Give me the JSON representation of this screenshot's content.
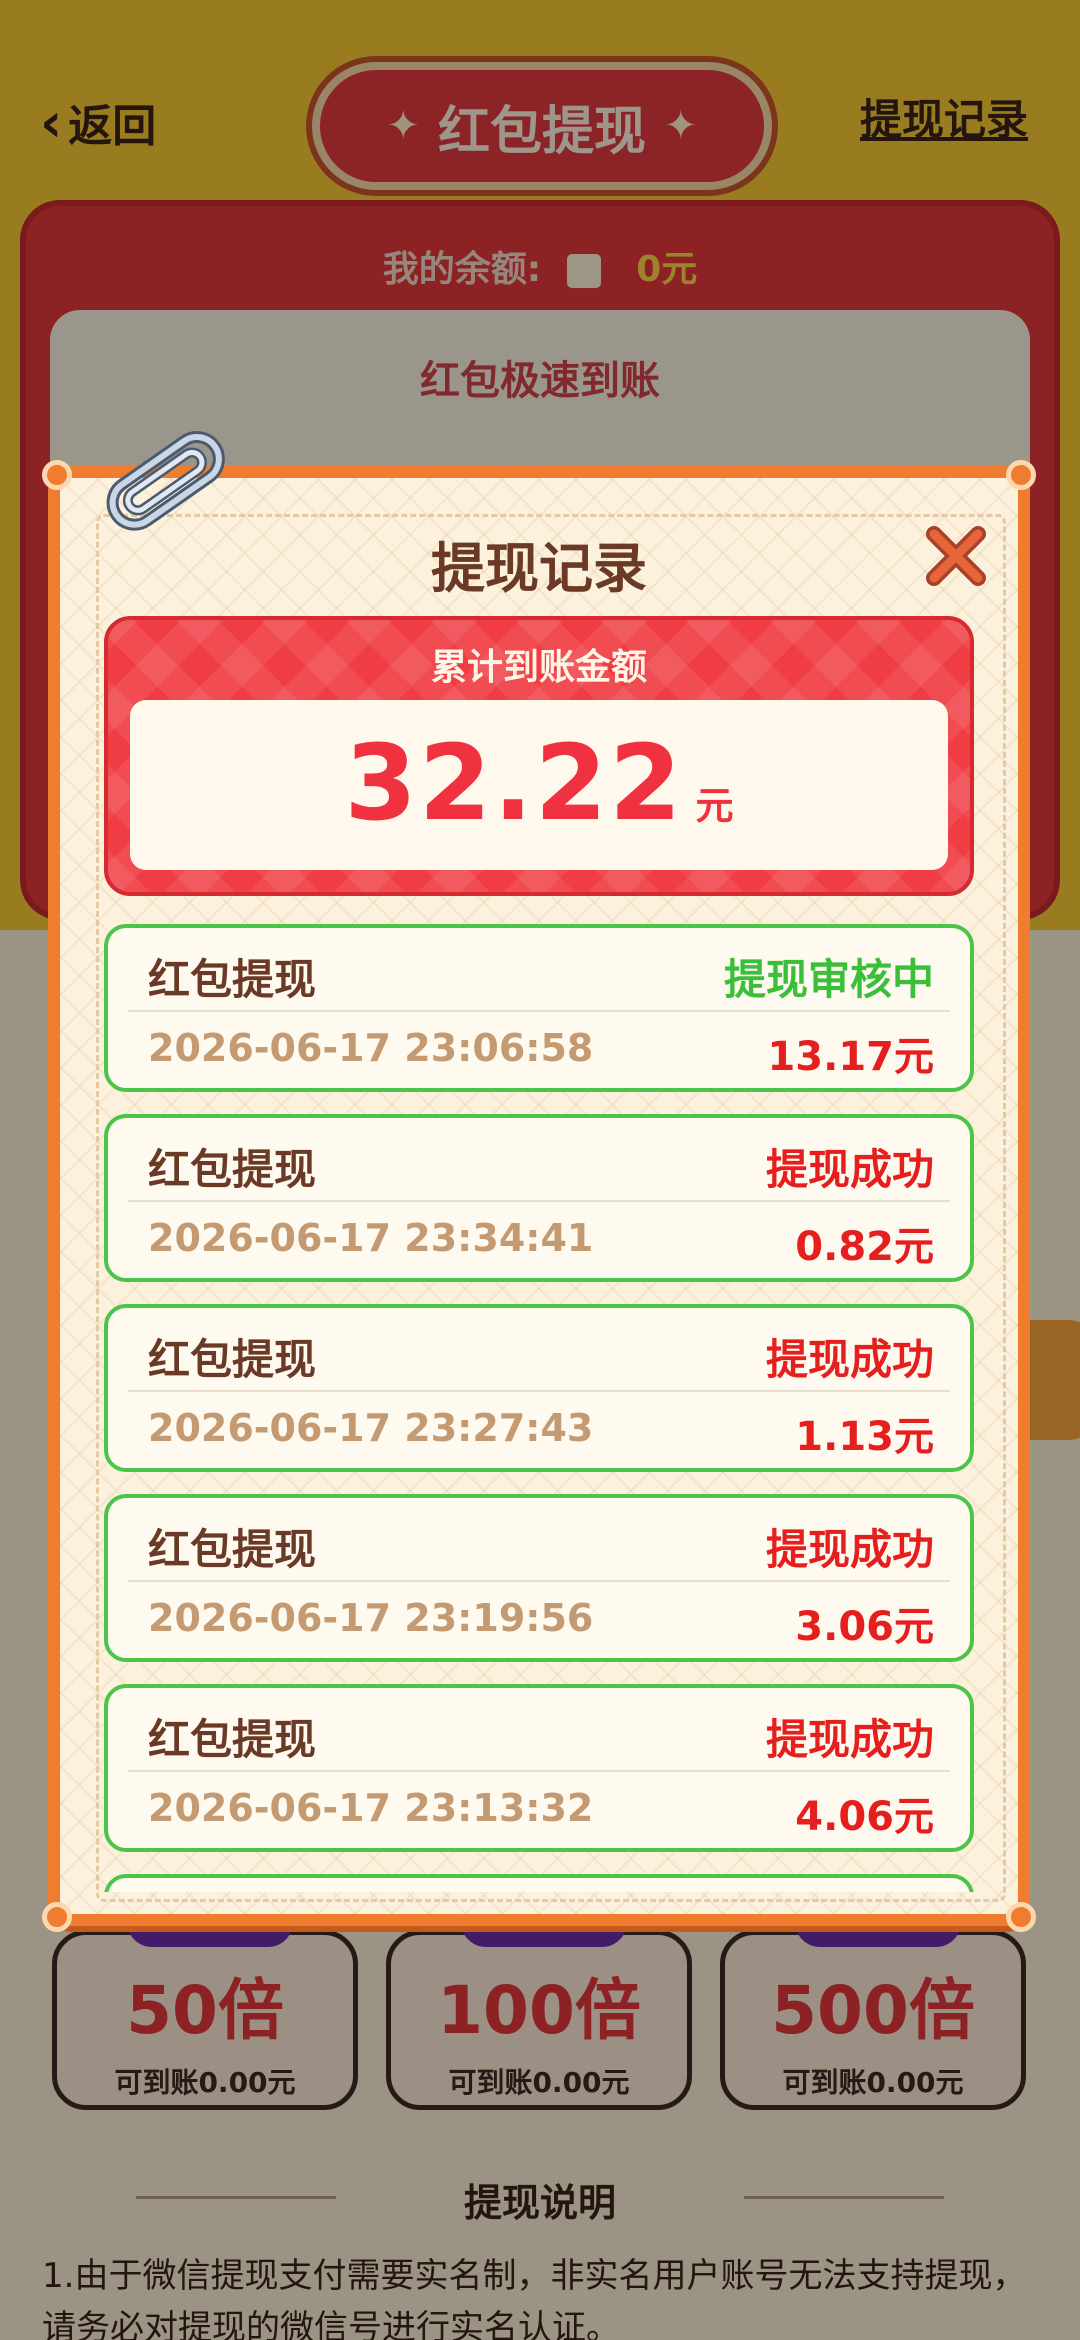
{
  "header": {
    "back_label": "返回",
    "title": "红包提现",
    "record_link": "提现记录"
  },
  "balance": {
    "label": "我的余额:",
    "amount": "0元",
    "speed_text": "红包极速到账"
  },
  "multipliers": [
    {
      "label": "50倍",
      "sub": "可到账0.00元"
    },
    {
      "label": "100倍",
      "sub": "可到账0.00元"
    },
    {
      "label": "500倍",
      "sub": "可到账0.00元"
    }
  ],
  "explain": {
    "title": "提现说明",
    "text": "1.由于微信提现支付需要实名制，非实名用户账号无法支持提现，请务必对提现的微信号进行实名认证。"
  },
  "modal": {
    "title": "提现记录",
    "total_label": "累计到账金额",
    "total_amount": "32.22",
    "total_unit": "元",
    "records": [
      {
        "name": "红包提现",
        "status": "提现审核中",
        "status_color": "#3bbf3b",
        "time": "2026-06-17 23:06:58",
        "amount": "13.17元"
      },
      {
        "name": "红包提现",
        "status": "提现成功",
        "status_color": "#e51e1e",
        "time": "2026-06-17 23:34:41",
        "amount": "0.82元"
      },
      {
        "name": "红包提现",
        "status": "提现成功",
        "status_color": "#e51e1e",
        "time": "2026-06-17 23:27:43",
        "amount": "1.13元"
      },
      {
        "name": "红包提现",
        "status": "提现成功",
        "status_color": "#e51e1e",
        "time": "2026-06-17 23:19:56",
        "amount": "3.06元"
      },
      {
        "name": "红包提现",
        "status": "提现成功",
        "status_color": "#e51e1e",
        "time": "2026-06-17 23:13:32",
        "amount": "4.06元"
      }
    ]
  },
  "colors": {
    "accent_red": "#ef3d43",
    "modal_orange": "#ef7c2f",
    "record_border_green": "#4bc44a",
    "pending_green": "#3bbf3b",
    "success_red": "#e51e1e"
  }
}
